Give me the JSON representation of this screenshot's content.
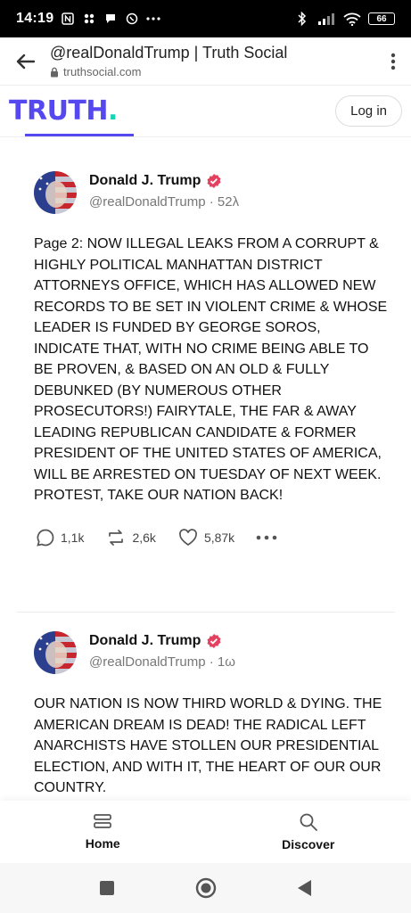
{
  "status_bar": {
    "time": "14:19",
    "battery": "66"
  },
  "browser": {
    "title": "@realDonaldTrump | Truth Social",
    "url": "truthsocial.com"
  },
  "site_header": {
    "logo_text": "TRUTH",
    "logo_dot": ".",
    "login_label": "Log in",
    "brand_color": "#5448ee",
    "accent_color": "#19d3b4"
  },
  "posts": [
    {
      "author_name": "Donald J. Trump",
      "handle": "@realDonaldTrump",
      "separator": " · ",
      "time_ago": "52λ",
      "text": "Page 2: NOW ILLEGAL LEAKS FROM A CORRUPT & HIGHLY POLITICAL MANHATTAN DISTRICT ATTORNEYS OFFICE, WHICH HAS ALLOWED NEW RECORDS TO BE SET IN VIOLENT CRIME & WHOSE LEADER IS FUNDED BY GEORGE SOROS, INDICATE THAT, WITH NO CRIME BEING ABLE TO BE PROVEN, & BASED ON AN OLD & FULLY DEBUNKED (BY NUMEROUS OTHER PROSECUTORS!) FAIRYTALE, THE FAR & AWAY LEADING REPUBLICAN CANDIDATE & FORMER PRESIDENT OF THE UNITED STATES OF AMERICA, WILL BE ARRESTED ON TUESDAY OF NEXT WEEK. PROTEST, TAKE OUR NATION BACK!",
      "replies": "1,1k",
      "retruths": "2,6k",
      "likes": "5,87k"
    },
    {
      "author_name": "Donald J. Trump",
      "handle": "@realDonaldTrump",
      "separator": " · ",
      "time_ago": "1ω",
      "text": "OUR NATION IS NOW THIRD WORLD & DYING. THE AMERICAN DREAM IS DEAD! THE RADICAL LEFT ANARCHISTS HAVE STOLLEN OUR PRESIDENTIAL ELECTION, AND WITH IT, THE HEART OF OUR OUR COUNTRY."
    }
  ],
  "bottom_nav": {
    "home_label": "Home",
    "discover_label": "Discover"
  }
}
